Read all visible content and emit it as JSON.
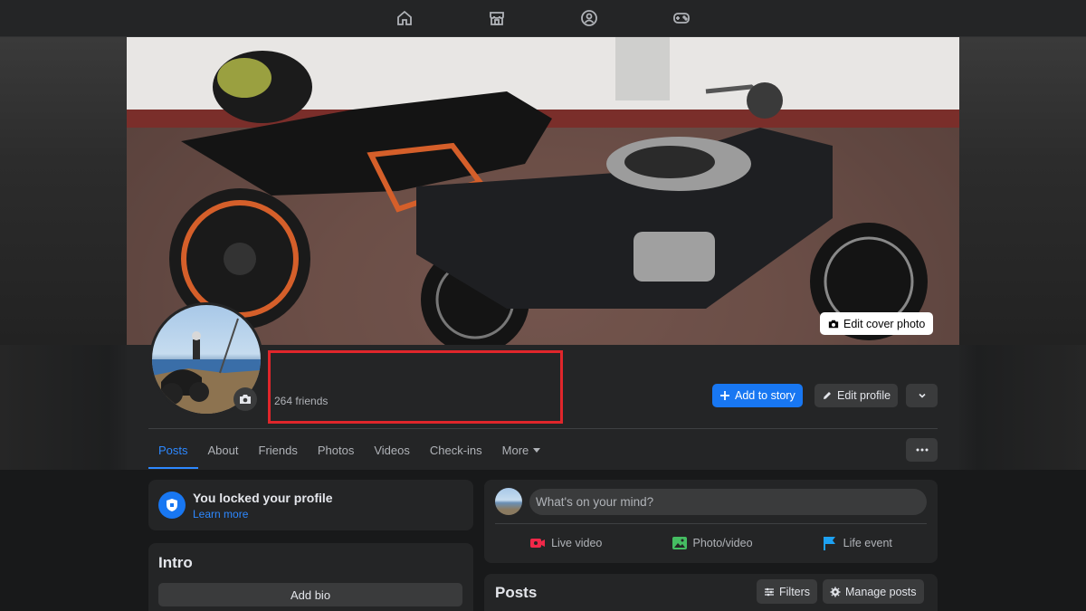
{
  "topnav": {
    "icons": [
      "home-icon",
      "marketplace-icon",
      "groups-icon",
      "gaming-icon"
    ]
  },
  "cover": {
    "edit_label": "Edit cover photo"
  },
  "profile": {
    "friends": "264 friends"
  },
  "actions": {
    "add_story": "Add to story",
    "edit_profile": "Edit profile"
  },
  "tabs": [
    {
      "label": "Posts",
      "active": true
    },
    {
      "label": "About"
    },
    {
      "label": "Friends"
    },
    {
      "label": "Photos"
    },
    {
      "label": "Videos"
    },
    {
      "label": "Check-ins"
    },
    {
      "label": "More"
    }
  ],
  "lock_notice": {
    "title": "You locked your profile",
    "link": "Learn more"
  },
  "intro": {
    "title": "Intro",
    "add_bio": "Add bio"
  },
  "composer": {
    "placeholder": "What's on your mind?",
    "live_video": "Live video",
    "photo_video": "Photo/video",
    "life_event": "Life event"
  },
  "posts": {
    "title": "Posts",
    "filters": "Filters",
    "manage": "Manage posts"
  },
  "colors": {
    "accent": "#1877f2",
    "highlight": "#e0262b",
    "live": "#f02849",
    "photo": "#45bd62",
    "life": "#1da1f2"
  }
}
